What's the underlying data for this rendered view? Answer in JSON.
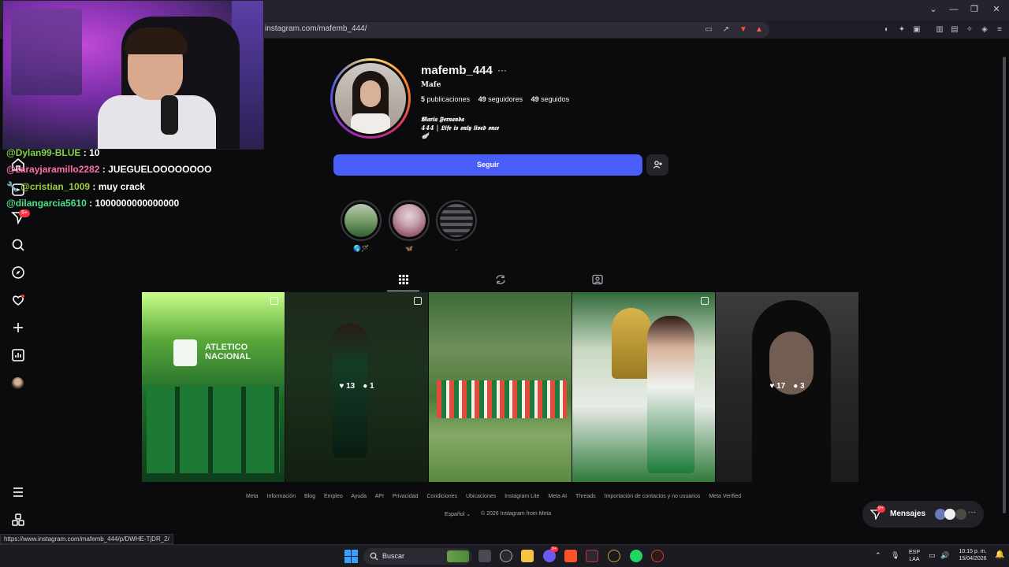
{
  "browser": {
    "url": "instagram.com/mafemb_444/",
    "status_url": "https://www.instagram.com/mafemb_444/p/DWHE-TjDR_2/"
  },
  "chat": [
    {
      "user": "@Dylan99-BLUE",
      "sep": " : ",
      "msg": "10",
      "color": "#7fd14a"
    },
    {
      "user": "@zarayjaramillo2282",
      "sep": " : ",
      "msg": "JUEGUELOOOOOOOO",
      "color": "#ff6fae"
    },
    {
      "user": "@cristian_1009",
      "sep": " : ",
      "msg": "muy crack",
      "color": "#9ccf3a"
    },
    {
      "user": "@dilangarcia5610",
      "sep": " : ",
      "msg": "1000000000000000",
      "color": "#4fe08a"
    }
  ],
  "rail": {
    "badge": "9+",
    "icons": [
      "home-icon",
      "reels-icon",
      "direct-icon",
      "search-icon",
      "explore-icon",
      "notifications-icon",
      "create-icon",
      "dashboard-icon",
      "profile-avatar",
      "menu-icon",
      "apps-icon"
    ]
  },
  "profile": {
    "username": "mafemb_444",
    "more": "···",
    "full_name": "Mafe",
    "stats": {
      "posts_count": "5",
      "posts_label": " publicaciones",
      "followers_count": "49",
      "followers_label": " seguidores",
      "following_count": "49",
      "following_label": " seguidos"
    },
    "bio_line1": "𝕸𝖆𝖗𝖎𝖆 𝕱𝖊𝖗𝖓𝖆𝖓𝖉𝖆",
    "bio_line2": "444 | 𝕷𝖎𝖋𝖊 𝖎𝖘 𝖔𝖓𝖑𝖞 𝖑𝖎𝖛𝖊𝖉 𝖔𝖓𝖈𝖊",
    "bio_line3": "🪽",
    "follow_label": "Seguir",
    "suggest_icon": "person-add-icon"
  },
  "highlights": [
    {
      "label": "🌎🪄",
      "colors": [
        "#7fa36e",
        "#2f5f2f"
      ]
    },
    {
      "label": "🦋",
      "colors": [
        "#c7a8b4",
        "#7a2a3a"
      ]
    },
    {
      "label": ".",
      "colors": [
        "#5a5a5e",
        "#1d1d20"
      ]
    }
  ],
  "tabs": [
    {
      "name": "tab-posts",
      "icon": "grid-icon",
      "active": true
    },
    {
      "name": "tab-reposts",
      "icon": "repost-icon",
      "active": false
    },
    {
      "name": "tab-tagged",
      "icon": "tagged-icon",
      "active": false
    }
  ],
  "posts": [
    {
      "likes": "",
      "comments": "",
      "multi": true,
      "hover": false
    },
    {
      "likes": "13",
      "comments": "1",
      "multi": true,
      "hover": true
    },
    {
      "likes": "",
      "comments": "",
      "multi": false,
      "hover": false
    },
    {
      "likes": "",
      "comments": "",
      "multi": true,
      "hover": false
    },
    {
      "likes": "17",
      "comments": "3",
      "multi": false,
      "hover": true
    }
  ],
  "footer": {
    "links": [
      "Meta",
      "Información",
      "Blog",
      "Empleo",
      "Ayuda",
      "API",
      "Privacidad",
      "Condiciones",
      "Ubicaciones",
      "Instagram Lite",
      "Meta AI",
      "Threads",
      "Importación de contactos y no usuarios",
      "Meta Verified"
    ],
    "language": "Español",
    "copyright": "© 2026 Instagram from Meta"
  },
  "messages": {
    "label": "Mensajes",
    "badge": "9+"
  },
  "taskbar": {
    "search_placeholder": "Buscar",
    "lang_top": "ESP",
    "lang_bottom": "LAA",
    "time": "10:15 p. m.",
    "date": "15/04/2026",
    "badge": "9+"
  },
  "colors": {
    "follow_blue": "#4a5df9",
    "notif_red": "#ff3040",
    "bg": "#0b0b0d"
  }
}
